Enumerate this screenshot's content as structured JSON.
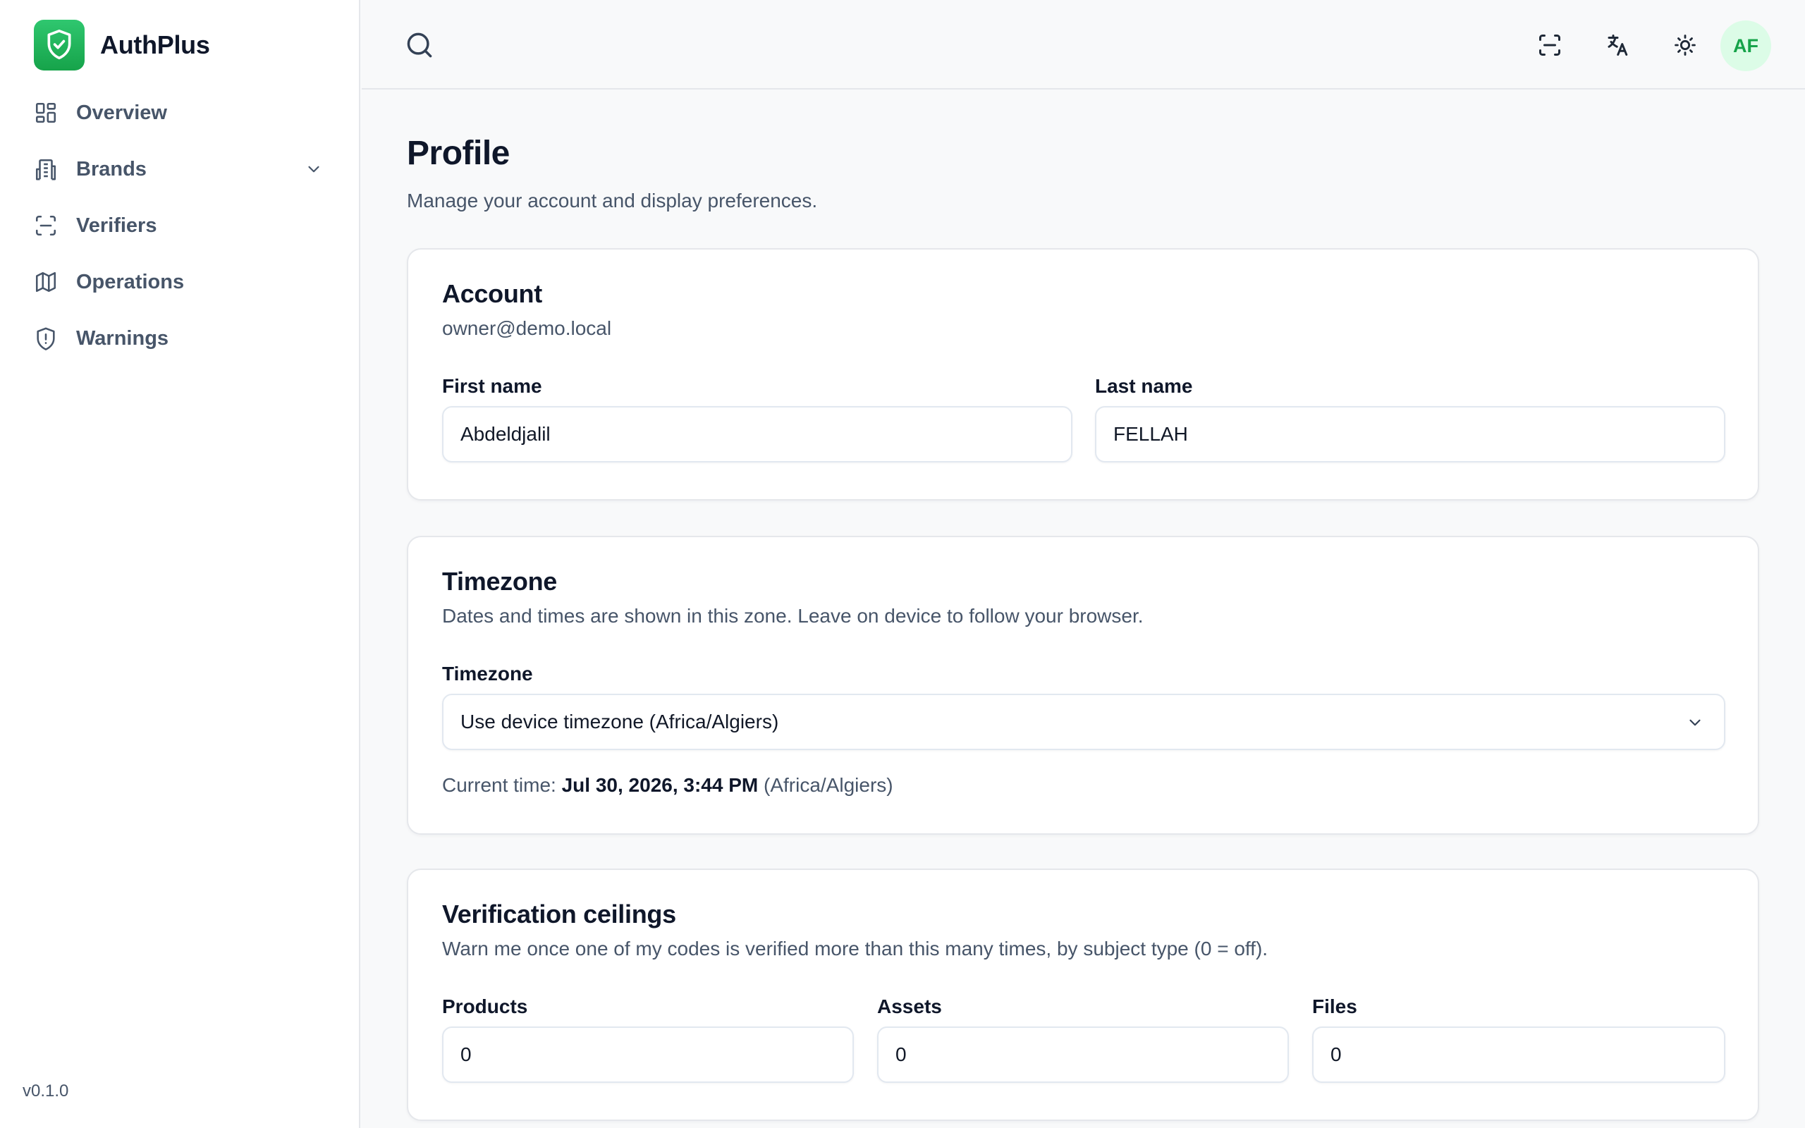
{
  "app": {
    "name": "AuthPlus",
    "version": "v0.1.0"
  },
  "sidebar": {
    "items": [
      {
        "label": "Overview",
        "icon": "dashboard-icon"
      },
      {
        "label": "Brands",
        "icon": "building-icon",
        "expandable": true
      },
      {
        "label": "Verifiers",
        "icon": "scan-icon"
      },
      {
        "label": "Operations",
        "icon": "map-icon"
      },
      {
        "label": "Warnings",
        "icon": "shield-alert-icon"
      }
    ]
  },
  "topbar": {
    "icons": [
      "search-icon",
      "scan-icon",
      "translate-icon",
      "sun-icon"
    ],
    "avatar_initials": "AF"
  },
  "page": {
    "title": "Profile",
    "subtitle": "Manage your account and display preferences."
  },
  "account": {
    "title": "Account",
    "email": "owner@demo.local",
    "first_name_label": "First name",
    "first_name_value": "Abdeldjalil",
    "last_name_label": "Last name",
    "last_name_value": "FELLAH"
  },
  "timezone": {
    "title": "Timezone",
    "description": "Dates and times are shown in this zone. Leave on device to follow your browser.",
    "field_label": "Timezone",
    "selected": "Use device timezone (Africa/Algiers)",
    "current_time_label": "Current time:",
    "current_time_value": "Jul 30, 2026, 3:44 PM",
    "current_time_zone": "(Africa/Algiers)"
  },
  "ceilings": {
    "title": "Verification ceilings",
    "description": "Warn me once one of my codes is verified more than this many times, by subject type (0 = off).",
    "products_label": "Products",
    "products_value": "0",
    "assets_label": "Assets",
    "assets_value": "0",
    "files_label": "Files",
    "files_value": "0"
  },
  "colors": {
    "accent": "#16a34a",
    "avatar_bg": "#dcfce7",
    "text_muted": "#475569"
  }
}
